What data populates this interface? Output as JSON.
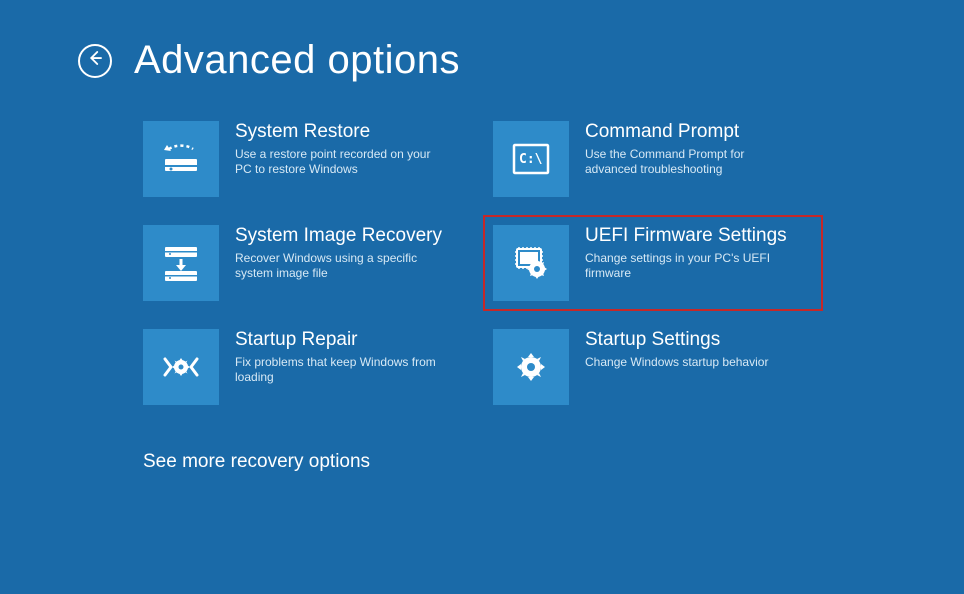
{
  "page_title": "Advanced options",
  "options": [
    {
      "title": "System Restore",
      "desc": "Use a restore point recorded on your PC to restore Windows",
      "icon": "restore-icon",
      "highlighted": false
    },
    {
      "title": "Command Prompt",
      "desc": "Use the Command Prompt for advanced troubleshooting",
      "icon": "cmd-icon",
      "highlighted": false
    },
    {
      "title": "System Image Recovery",
      "desc": "Recover Windows using a specific system image file",
      "icon": "image-recovery-icon",
      "highlighted": false
    },
    {
      "title": "UEFI Firmware Settings",
      "desc": "Change settings in your PC's UEFI firmware",
      "icon": "uefi-icon",
      "highlighted": true
    },
    {
      "title": "Startup Repair",
      "desc": "Fix problems that keep Windows from loading",
      "icon": "repair-icon",
      "highlighted": false
    },
    {
      "title": "Startup Settings",
      "desc": "Change Windows startup behavior",
      "icon": "settings-icon",
      "highlighted": false
    }
  ],
  "see_more_label": "See more recovery options"
}
